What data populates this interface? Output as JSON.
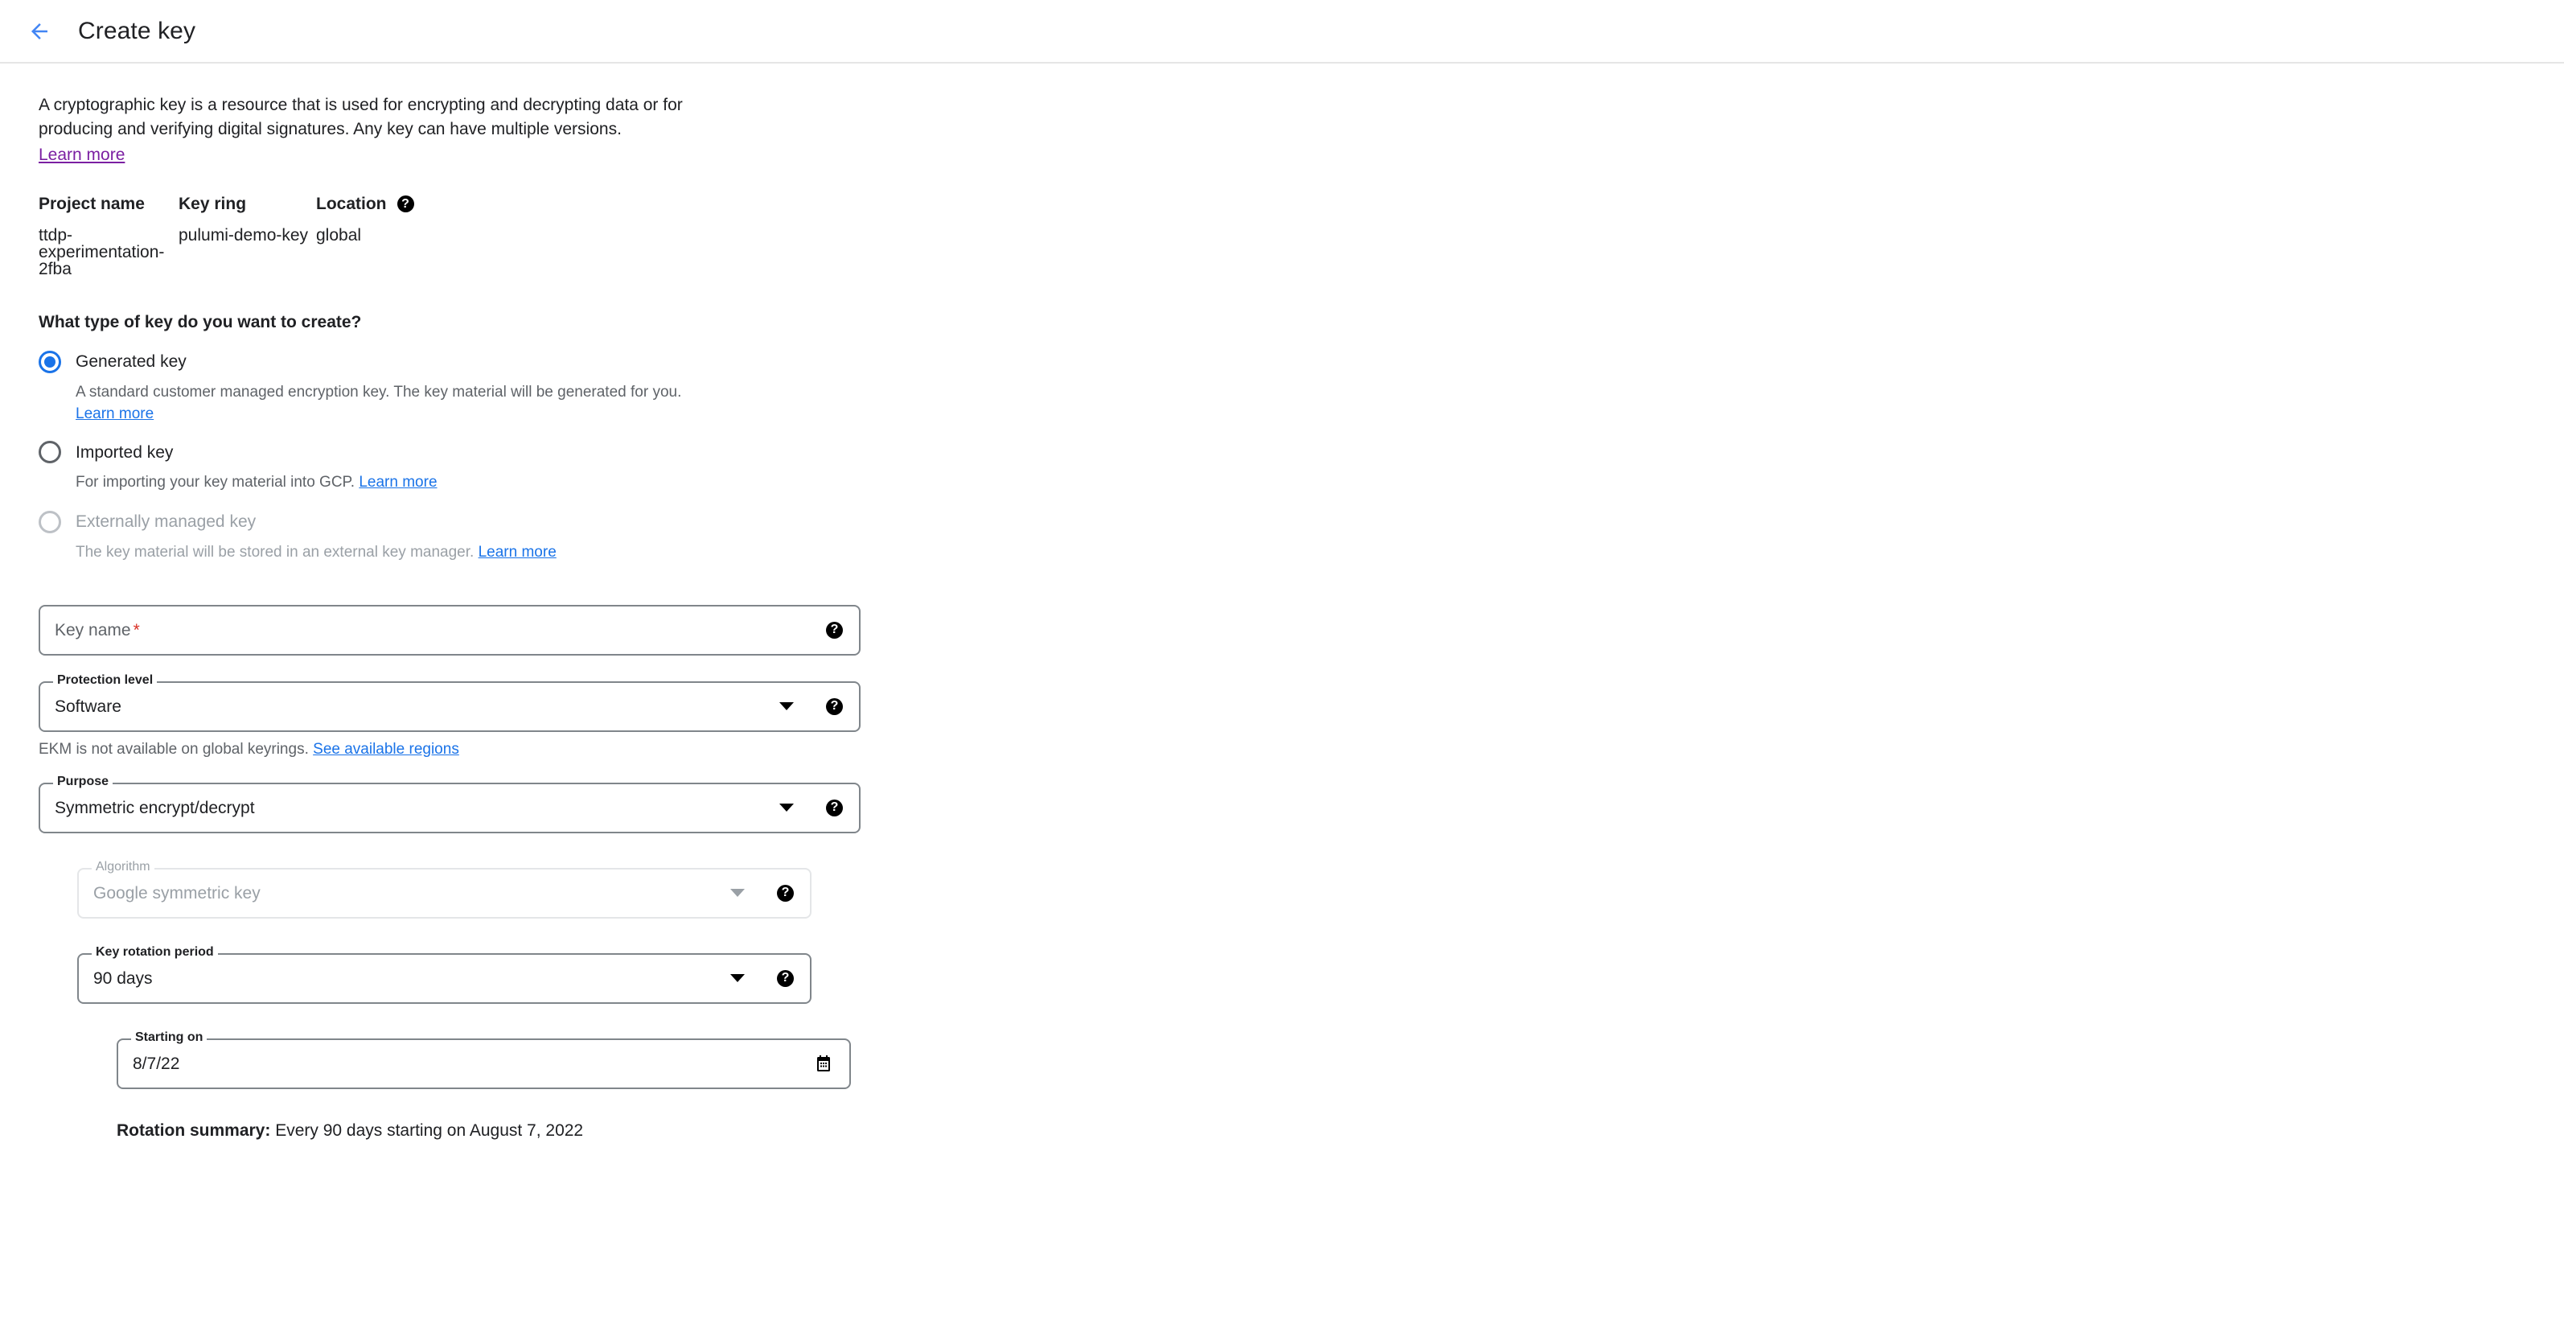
{
  "header": {
    "back_icon": "arrow-back-icon",
    "title": "Create key"
  },
  "intro": {
    "line1": "A cryptographic key is a resource that is used for encrypting and decrypting data or for",
    "line2": "producing and verifying digital signatures. Any key can have multiple versions.",
    "learn_more": "Learn more"
  },
  "info": {
    "project_name_label": "Project name",
    "project_name_value": "ttdp-experimentation-2fba",
    "key_ring_label": "Key ring",
    "key_ring_value": "pulumi-demo-key",
    "location_label": "Location",
    "location_value": "global",
    "location_help_icon": "help-icon"
  },
  "key_type": {
    "question": "What type of key do you want to create?",
    "options": [
      {
        "label": "Generated key",
        "description": "A standard customer managed encryption key. The key material will be generated for you.",
        "link": "Learn more",
        "link_inline": false,
        "selected": true,
        "disabled": false
      },
      {
        "label": "Imported key",
        "description": "For importing your key material into GCP.",
        "link": "Learn more",
        "link_inline": true,
        "selected": false,
        "disabled": false
      },
      {
        "label": "Externally managed key",
        "description": "The key material will be stored in an external key manager.",
        "link": "Learn more",
        "link_inline": true,
        "selected": false,
        "disabled": true
      }
    ]
  },
  "fields": {
    "key_name": {
      "placeholder": "Key name",
      "value": "",
      "required_marker": "*",
      "help_icon": "help-icon"
    },
    "protection_level": {
      "label": "Protection level",
      "value": "Software",
      "caret_icon": "chevron-down-icon",
      "help_icon": "help-icon",
      "hint_text": "EKM is not available on global keyrings.",
      "hint_link": "See available regions"
    },
    "purpose": {
      "label": "Purpose",
      "value": "Symmetric encrypt/decrypt",
      "caret_icon": "chevron-down-icon",
      "help_icon": "help-icon"
    },
    "algorithm": {
      "label": "Algorithm",
      "value": "Google symmetric key",
      "caret_icon": "chevron-down-icon",
      "help_icon": "help-icon",
      "disabled": true
    },
    "key_rotation_period": {
      "label": "Key rotation period",
      "value": "90 days",
      "caret_icon": "chevron-down-icon",
      "help_icon": "help-icon"
    },
    "starting_on": {
      "label": "Starting on",
      "value": "8/7/22",
      "calendar_icon": "calendar-icon"
    }
  },
  "rotation_summary": {
    "label": "Rotation summary:",
    "text": " Every 90 days starting on August 7, 2022"
  },
  "colors": {
    "accent_blue": "#1a73e8",
    "visited_purple": "#7b1fa2",
    "required_red": "#d93025",
    "border_gray": "#80868b",
    "disabled_gray": "#9aa0a6"
  }
}
